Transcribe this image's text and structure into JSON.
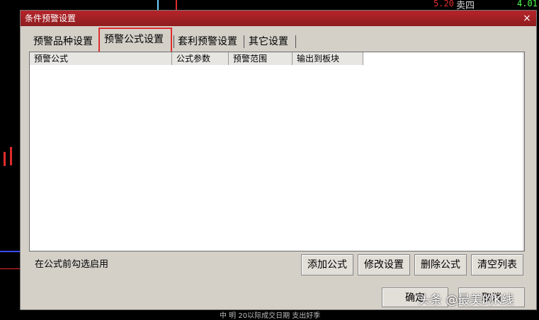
{
  "background": {
    "top_price": "5.20",
    "top_label": "卖四",
    "top_value": "4.01",
    "bottom_text": "中 明 20以际成交日期 支出好季"
  },
  "dialog": {
    "title": "条件预警设置",
    "close_label": "×"
  },
  "tabs": [
    {
      "label": "预警品种设置",
      "active": false
    },
    {
      "label": "预警公式设置",
      "active": true
    },
    {
      "label": "套利预警设置",
      "active": false
    },
    {
      "label": "其它设置",
      "active": false
    }
  ],
  "columns": [
    "预警公式",
    "公式参数",
    "预警范围",
    "输出到板块"
  ],
  "footer": {
    "hint": "在公式前勾选启用"
  },
  "buttons": {
    "add": "添加公式",
    "modify": "修改设置",
    "delete": "删除公式",
    "clear": "清空列表",
    "ok": "确定",
    "cancel": "取消"
  },
  "watermark": "头条 @最美的K线",
  "colors": {
    "title_bar": "#a72024",
    "highlight": "#e02c2c"
  }
}
